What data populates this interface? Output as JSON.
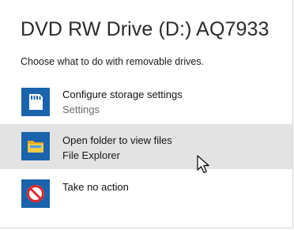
{
  "dialog": {
    "title": "DVD RW Drive (D:) AQ7933",
    "prompt": "Choose what to do with removable drives."
  },
  "options": [
    {
      "label": "Configure storage settings",
      "sub": "Settings",
      "icon": "sd-card-icon",
      "selected": false
    },
    {
      "label": "Open folder to view files",
      "sub": "File Explorer",
      "icon": "folder-icon",
      "selected": true
    },
    {
      "label": "Take no action",
      "sub": "",
      "icon": "no-entry-icon",
      "selected": false
    }
  ],
  "colors": {
    "icon_tile": "#1b63ad",
    "selected_row": "#e3e3e3",
    "folder_yellow": "#f7c948",
    "no_entry_red": "#e0262d"
  }
}
